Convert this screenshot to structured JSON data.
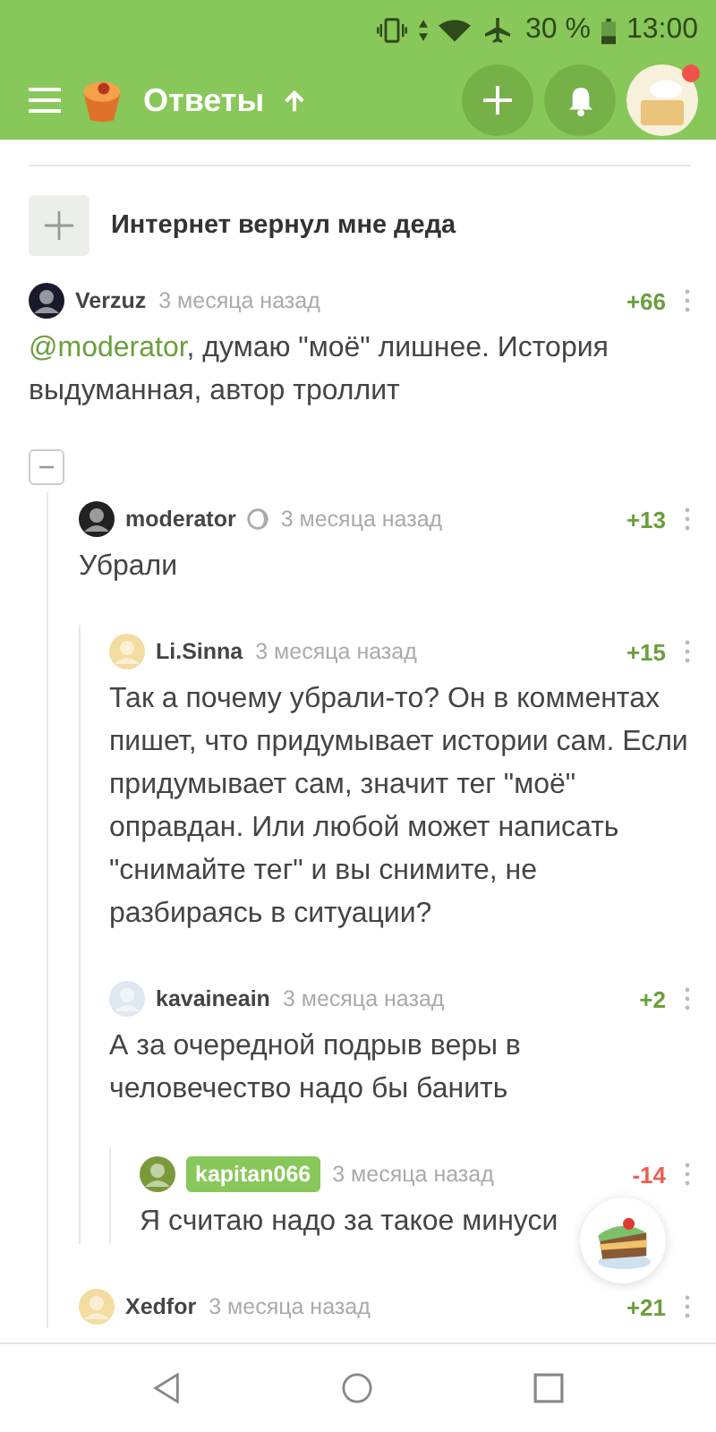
{
  "status_bar": {
    "battery": "30 %",
    "time": "13:00"
  },
  "toolbar": {
    "title": "Ответы",
    "notification": true
  },
  "post": {
    "title": "Интернет вернул мне деда"
  },
  "comments": [
    {
      "author": "Verzuz",
      "time": "3 месяца назад",
      "score": "+66",
      "mention": "@moderator",
      "text": ", думаю \"моё\" лишнее. История выдуманная, автор троллит",
      "expanded": true,
      "children": [
        {
          "author": "moderator",
          "moderator_badge": true,
          "time": "3 месяца назад",
          "score": "+13",
          "text": "Убрали",
          "children": [
            {
              "author": "Li.Sinna",
              "time": "3 месяца назад",
              "score": "+15",
              "text": "Так а почему убрали-то? Он в комментах пишет, что придумывает истории сам. Если придумывает сам, значит тег \"моё\" оправдан. Или любой может написать \"снимайте тег\" и вы снимите, не разбираясь в ситуации?"
            },
            {
              "author": "kavaineain",
              "time": "3 месяца назад",
              "score": "+2",
              "text": "А за очередной подрыв веры в человечество надо бы банить",
              "children": [
                {
                  "author": "kapitan066",
                  "author_highlighted": true,
                  "time": "3 месяца назад",
                  "score": "-14",
                  "text": "Я считаю надо за такое минуси"
                }
              ]
            }
          ]
        },
        {
          "author": "Xedfor",
          "time": "3 месяца назад",
          "score": "+21"
        }
      ]
    }
  ]
}
